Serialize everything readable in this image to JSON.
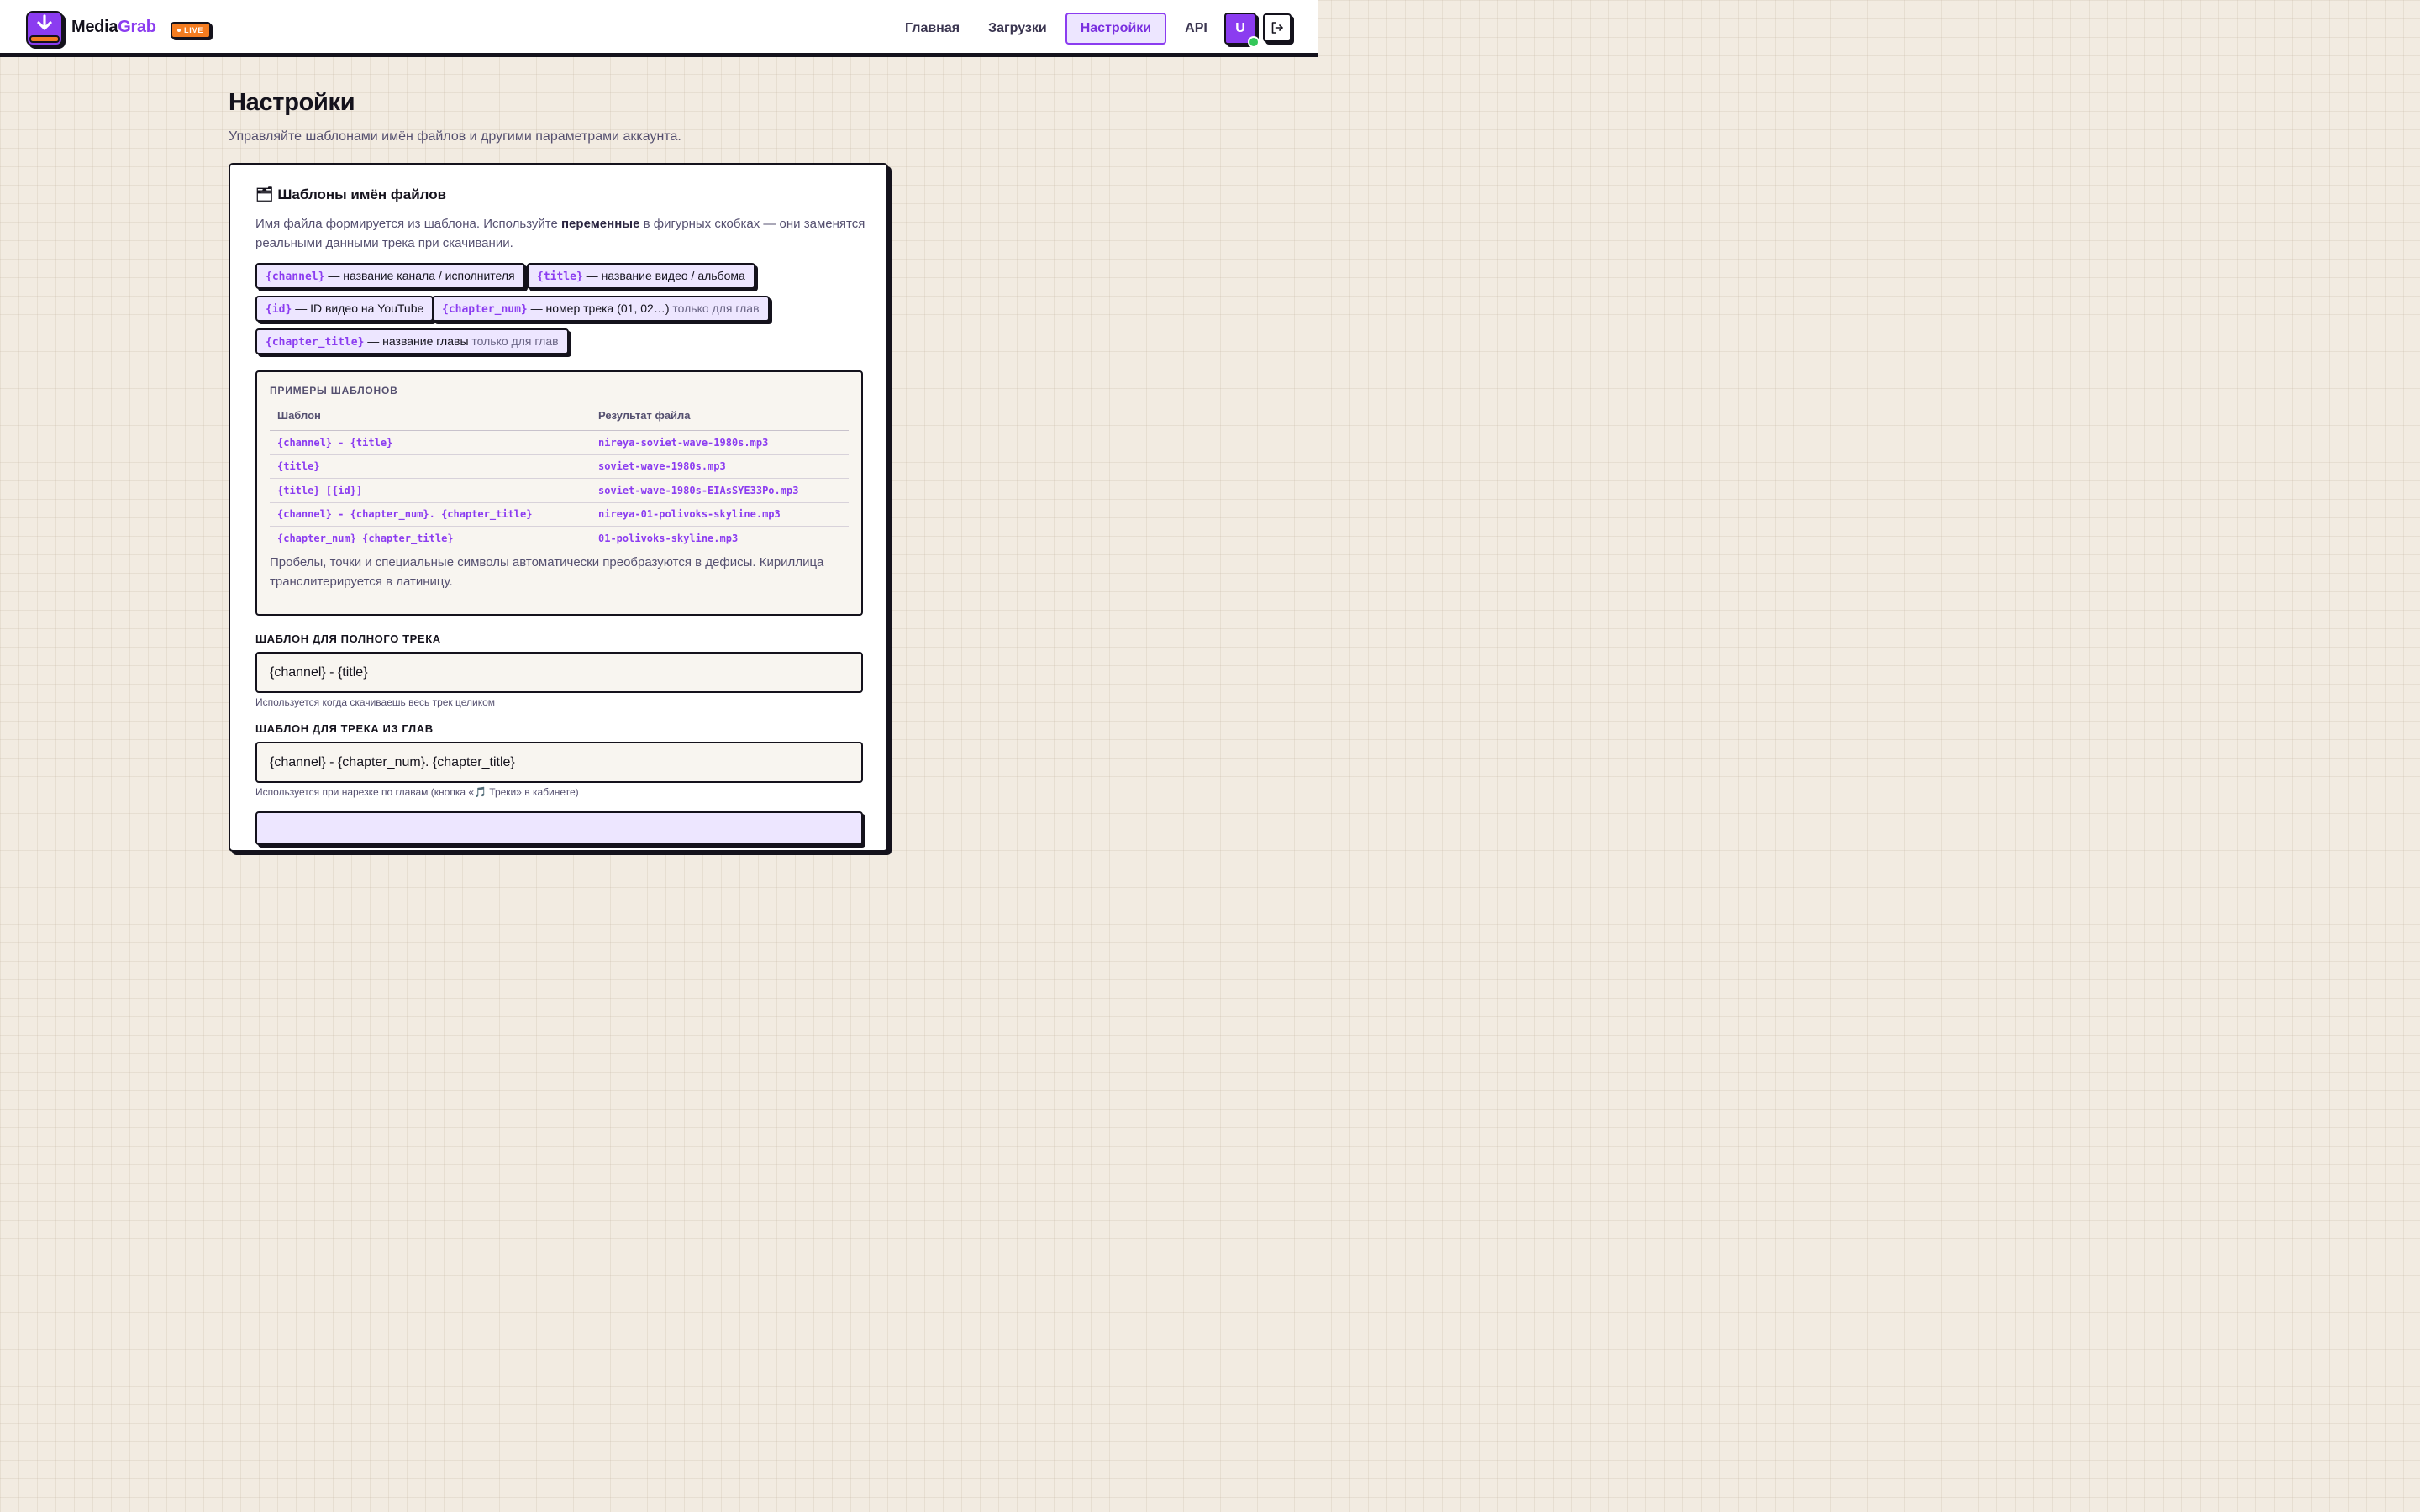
{
  "app": {
    "brand_part1": "Media",
    "brand_part2": "Grab",
    "live_badge": "LIVE",
    "accent_color": "#8b3cf0",
    "badge_color": "#f47c20"
  },
  "nav": {
    "items": [
      {
        "label": "Главная"
      },
      {
        "label": "Загрузки"
      },
      {
        "label": "Настройки"
      },
      {
        "label": "API"
      }
    ],
    "active_index": 2
  },
  "user": {
    "avatar_letter": "U",
    "online": true
  },
  "page": {
    "title": "Настройки",
    "subtitle": "Управляйте шаблонами имён файлов и другими параметрами аккаунта."
  },
  "card": {
    "icon": "🗂",
    "title": "Шаблоны имён файлов",
    "desc_before": "Имя файла формируется из шаблона. Используйте ",
    "desc_bold": "переменные",
    "desc_after": " в фигурных скобках — они заменятся реальными данными трека при скачивании.",
    "chips": [
      {
        "var": "{channel}",
        "desc": " — название канала / исполнителя",
        "note": ""
      },
      {
        "var": "{title}",
        "desc": " — название видео / альбома",
        "note": ""
      },
      {
        "var": "{id}",
        "desc": " — ID видео на YouTube",
        "note": ""
      },
      {
        "var": "{chapter_num}",
        "desc": " — номер трека (01, 02…)",
        "note": " только для глав"
      },
      {
        "var": "{chapter_title}",
        "desc": " — название главы",
        "note": " только для глав"
      }
    ]
  },
  "examples": {
    "heading": "ПРИМЕРЫ ШАБЛОНОВ",
    "col_template": "Шаблон",
    "col_result": "Результат файла",
    "rows": [
      {
        "template": "{channel} - {title}",
        "result": "nireya-soviet-wave-1980s.mp3"
      },
      {
        "template": "{title}",
        "result": "soviet-wave-1980s.mp3"
      },
      {
        "template": "{title} [{id}]",
        "result": "soviet-wave-1980s-EIAsSYE33Po.mp3"
      },
      {
        "template": "{channel} - {chapter_num}. {chapter_title}",
        "result": "nireya-01-polivoks-skyline.mp3"
      },
      {
        "template": "{chapter_num} {chapter_title}",
        "result": "01-polivoks-skyline.mp3"
      }
    ],
    "note": "Пробелы, точки и специальные символы автоматически преобразуются в дефисы. Кириллица транслитерируется в латиницу."
  },
  "fields": {
    "full": {
      "label": "ШАБЛОН ДЛЯ ПОЛНОГО ТРЕКА",
      "value": "{channel} - {title}",
      "hint": "Используется когда скачиваешь весь трек целиком"
    },
    "chapter": {
      "label": "ШАБЛОН ДЛЯ ТРЕКА ИЗ ГЛАВ",
      "value": "{channel} - {chapter_num}. {chapter_title}",
      "hint": "Используется при нарезке по главам (кнопка «🎵 Треки» в кабинете)"
    }
  }
}
